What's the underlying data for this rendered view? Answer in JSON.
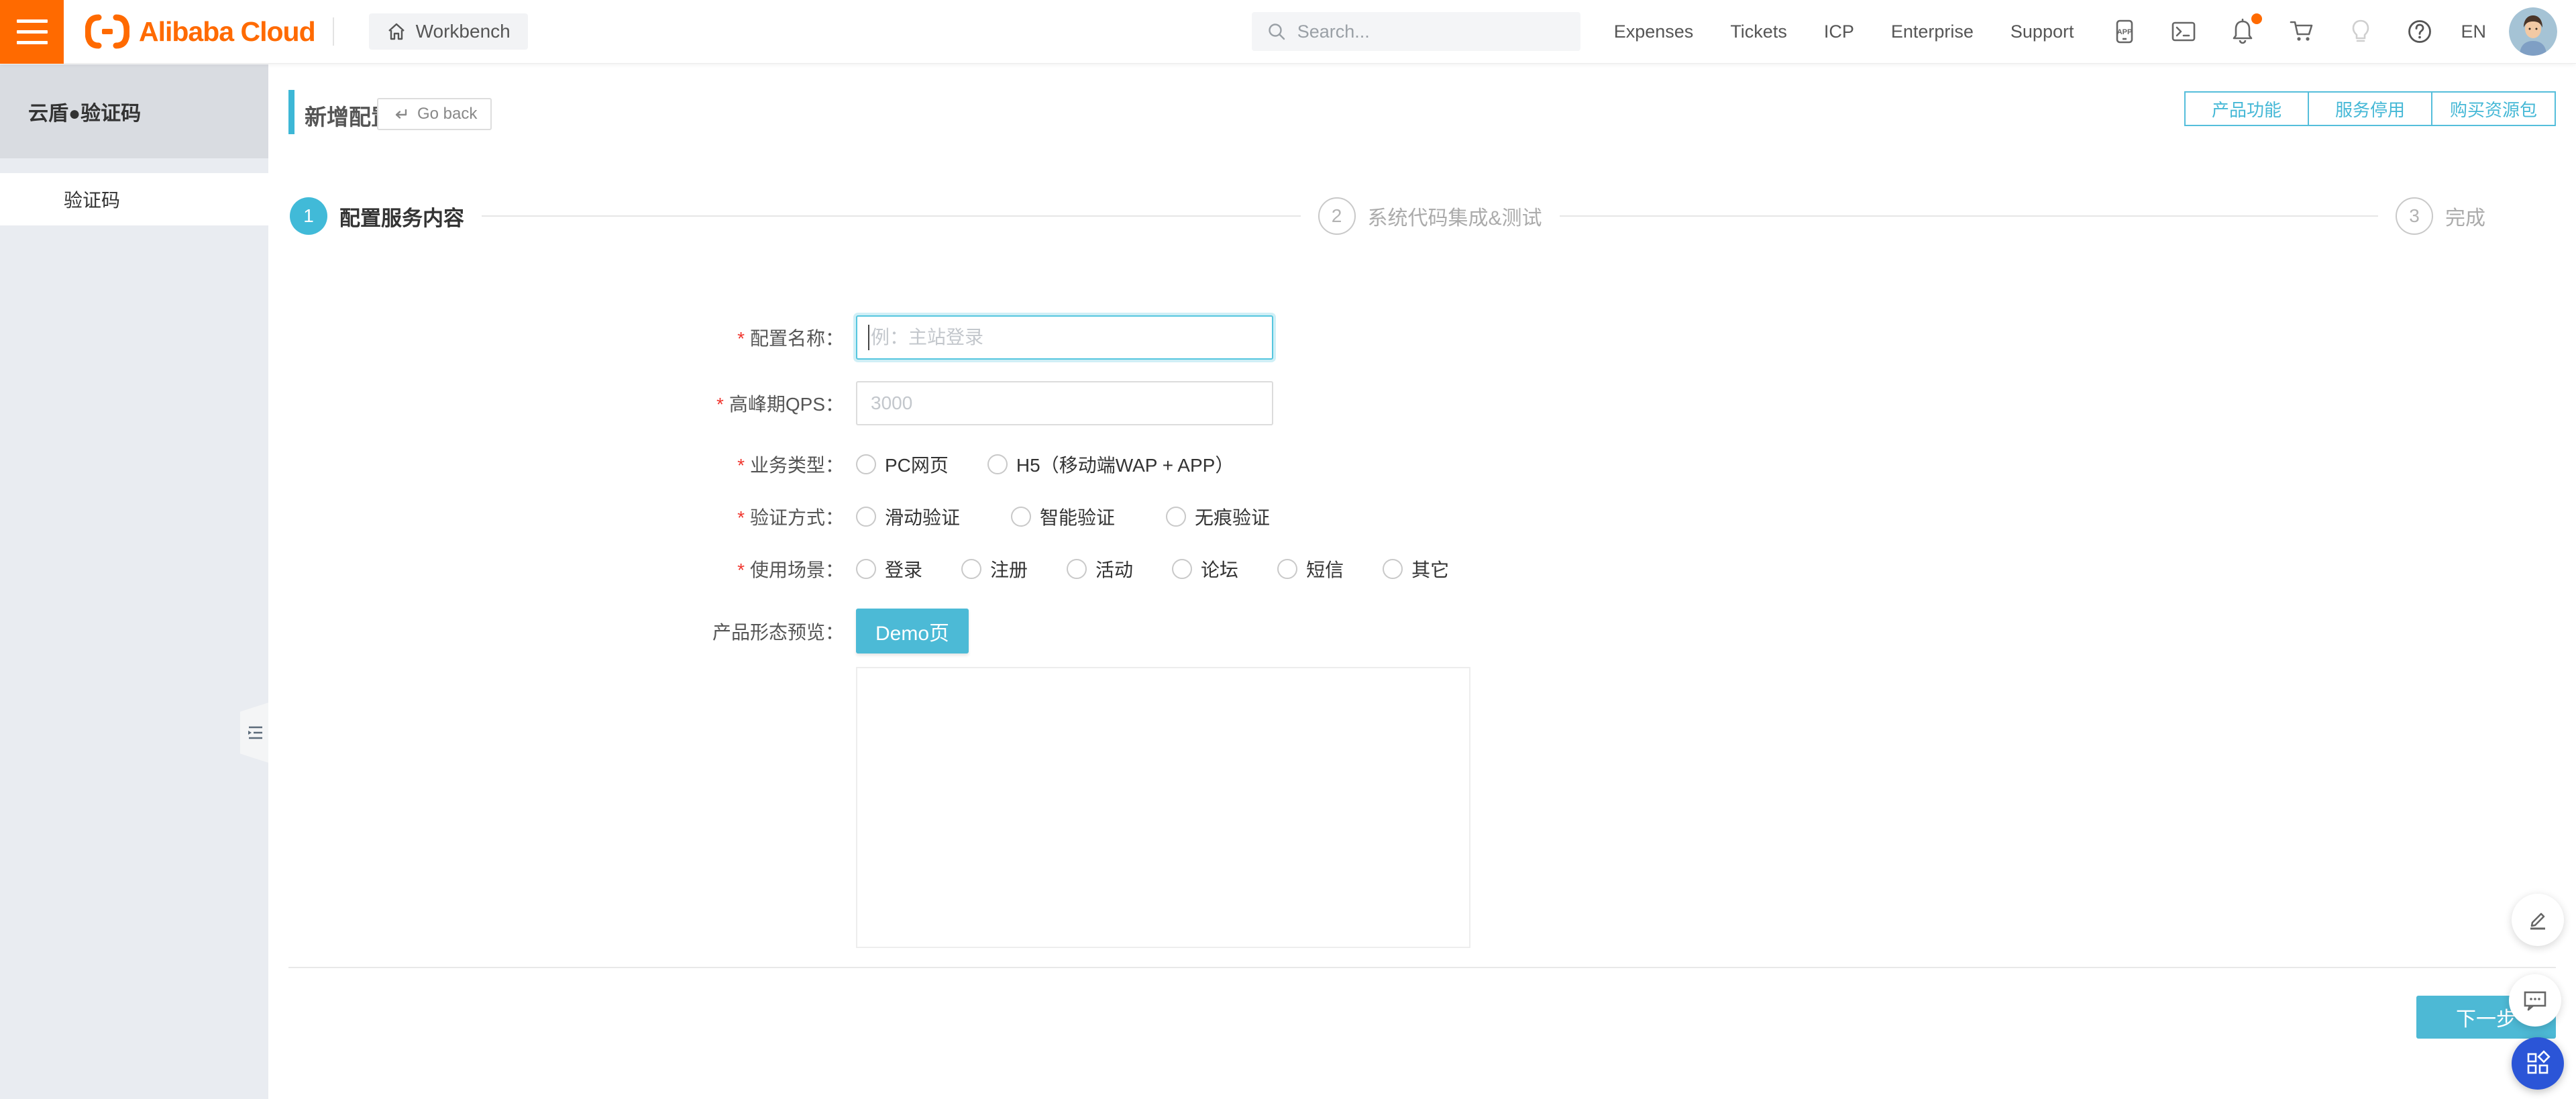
{
  "topbar": {
    "brand": "Alibaba Cloud",
    "workbench_label": "Workbench",
    "search_placeholder": "Search...",
    "nav": [
      "Expenses",
      "Tickets",
      "ICP",
      "Enterprise",
      "Support"
    ],
    "language": "EN"
  },
  "sidebar": {
    "title": "云盾●验证码",
    "items": [
      {
        "label": "验证码",
        "active": true
      }
    ]
  },
  "page": {
    "title": "新增配置",
    "go_back_label": "Go back",
    "actions": [
      "产品功能",
      "服务停用",
      "购买资源包"
    ],
    "steps": [
      {
        "num": "1",
        "label": "配置服务内容",
        "active": true
      },
      {
        "num": "2",
        "label": "系统代码集成&测试",
        "active": false
      },
      {
        "num": "3",
        "label": "完成",
        "active": false
      }
    ],
    "form": {
      "required_marker": "*",
      "fields": [
        {
          "label": "配置名称：",
          "placeholder": "例：主站登录",
          "value": ""
        },
        {
          "label": "高峰期QPS：",
          "placeholder": "3000",
          "value": ""
        }
      ],
      "radio_groups": [
        {
          "label": "业务类型：",
          "options": [
            "PC网页",
            "H5（移动端WAP + APP）"
          ]
        },
        {
          "label": "验证方式：",
          "options": [
            "滑动验证",
            "智能验证",
            "无痕验证"
          ]
        },
        {
          "label": "使用场景：",
          "options": [
            "登录",
            "注册",
            "活动",
            "论坛",
            "短信",
            "其它"
          ]
        }
      ],
      "preview_label": "产品形态预览：",
      "demo_button_label": "Demo页"
    },
    "next_button_label": "下一步"
  },
  "colors": {
    "accent_teal": "#3DB7D6",
    "button_fill_teal": "#4CBAD6",
    "brand_orange": "#FF6A00",
    "fab_blue": "#2B55D7",
    "required_red": "#f0372f"
  }
}
